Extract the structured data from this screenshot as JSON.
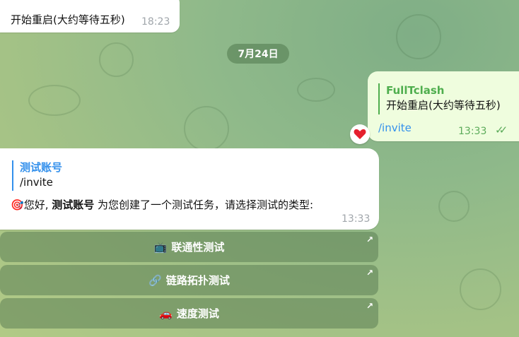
{
  "messages": {
    "top_in": {
      "text": "开始重启(大约等待五秒)",
      "time": "18:23"
    },
    "date_separator": "7月24日",
    "out": {
      "reply_author": "FullTclash",
      "reply_text": "开始重启(大约等待五秒)",
      "text": "/invite",
      "time": "13:33",
      "reaction_icon": "red-heart"
    },
    "bot": {
      "reply_author": "测试账号",
      "reply_text": "/invite",
      "icon": "target",
      "text_pre": "您好, ",
      "text_bold": "测试账号",
      "text_post": " 为您创建了一个测试任务，请选择测试的类型:",
      "time": "13:33"
    }
  },
  "keyboard": [
    {
      "icon": "tv",
      "icon_glyph": "📺",
      "label": "联通性测试"
    },
    {
      "icon": "link",
      "icon_glyph": "🔗",
      "label": "链路拓扑测试"
    },
    {
      "icon": "car",
      "icon_glyph": "🚗",
      "label": "速度测试"
    }
  ],
  "colors": {
    "link_blue": "#3390ec",
    "out_green": "#4fae4e",
    "heart_red": "#e5202e"
  }
}
